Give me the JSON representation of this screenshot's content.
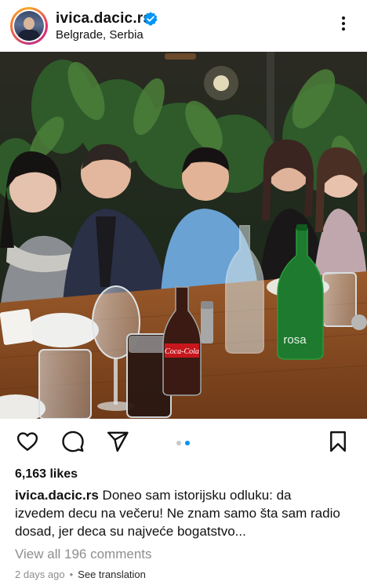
{
  "post": {
    "username": "ivica.dacic.rs",
    "location": "Belgrade, Serbia",
    "verified": true,
    "likes": "6,163 likes",
    "caption_user": "ivica.dacic.rs",
    "caption_text": "Doneo sam istorijsku odluku: da izvedem decu na večeru! Ne znam samo šta sam radio dosad, jer deca su najveće bogatstvo...",
    "view_comments": "View all 196 comments",
    "time_ago": "2 days ago",
    "see_translation": "See translation"
  },
  "photo": {
    "bottle_label_cola": "Coca-Cola",
    "bottle_label_water": "rosa"
  },
  "carousel": {
    "total": 2,
    "active_index": 1
  },
  "icons": {
    "more": "more-options-icon",
    "like": "heart-icon",
    "comment": "comment-icon",
    "share": "paper-plane-icon",
    "save": "bookmark-icon",
    "verified": "verified-badge-icon"
  },
  "colors": {
    "verified_blue": "#0095f6",
    "carousel_active": "#0095f6",
    "carousel_inactive": "#c7c7c7",
    "muted_text": "#8e8e8e"
  }
}
